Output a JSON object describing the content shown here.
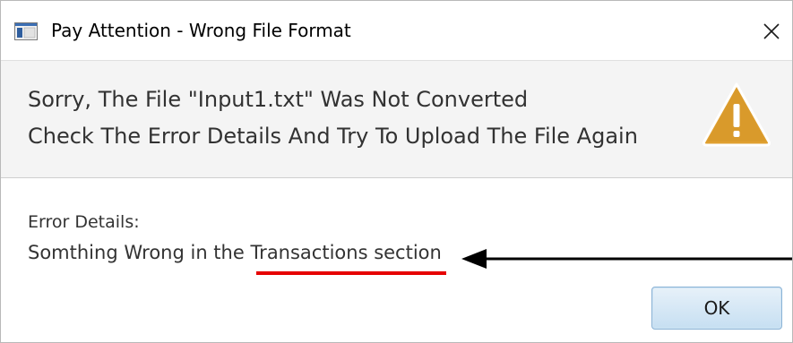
{
  "window": {
    "title": "Pay Attention - Wrong File Format"
  },
  "header": {
    "line1": "Sorry, The File \"Input1.txt\" Was Not Converted",
    "line2": "Check The Error Details And Try To Upload The File Again",
    "icon": "warning-icon"
  },
  "details": {
    "label": "Error Details:",
    "message": "Somthing Wrong in the Transactions section"
  },
  "buttons": {
    "ok_label": "OK"
  },
  "colors": {
    "warning_fill": "#e0a030",
    "annotation_underline": "#e60000",
    "annotation_arrow": "#000000",
    "ok_button_border": "#8ab3d6"
  }
}
